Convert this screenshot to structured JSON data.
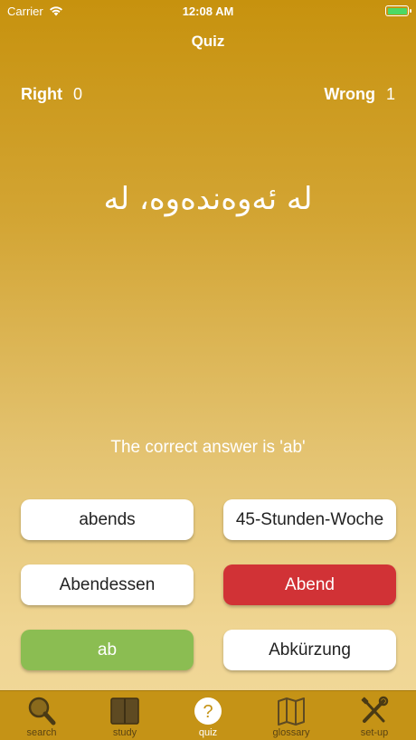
{
  "status": {
    "carrier": "Carrier",
    "time": "12:08 AM"
  },
  "nav": {
    "title": "Quiz"
  },
  "score": {
    "right_label": "Right",
    "right_value": "0",
    "wrong_label": "Wrong",
    "wrong_value": "1"
  },
  "question": "لە ئەوەندەوە، لە",
  "feedback": "The correct answer is 'ab'",
  "answers": [
    {
      "label": "abends",
      "state": "neutral"
    },
    {
      "label": "45-Stunden-Woche",
      "state": "neutral"
    },
    {
      "label": "Abendessen",
      "state": "neutral"
    },
    {
      "label": "Abend",
      "state": "wrong"
    },
    {
      "label": "ab",
      "state": "correct"
    },
    {
      "label": "Abkürzung",
      "state": "neutral"
    }
  ],
  "tabs": [
    {
      "label": "search",
      "icon": "search-icon"
    },
    {
      "label": "study",
      "icon": "book-icon"
    },
    {
      "label": "quiz",
      "icon": "question-icon",
      "active": true
    },
    {
      "label": "glossary",
      "icon": "map-icon"
    },
    {
      "label": "set-up",
      "icon": "tools-icon"
    }
  ],
  "colors": {
    "wrong": "#d13236",
    "correct": "#8bbd52",
    "tab_bar": "#c59316",
    "background_top": "#c7920e",
    "background_bottom": "#f2d99b"
  }
}
